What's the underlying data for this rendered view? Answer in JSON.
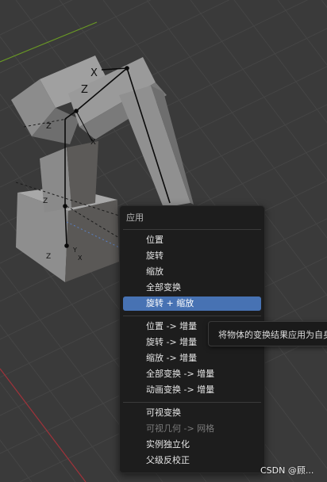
{
  "colors": {
    "viewport_bg": "#3a3a3a",
    "grid_line": "#454545",
    "x_axis": "#a0323a",
    "y_axis": "#6a9a24",
    "menu_bg": "#1d1d1d",
    "menu_highlight": "#4772b3",
    "mesh_light": "#9b9b9b",
    "mesh_dark": "#5c5a58"
  },
  "viewport": {
    "bone_labels": [
      "X",
      "Z",
      "Z",
      "X",
      "Z",
      "Z",
      "Y",
      "X"
    ]
  },
  "menu": {
    "title": "应用",
    "items": [
      {
        "label": "位置"
      },
      {
        "label": "旋转"
      },
      {
        "label": "缩放"
      },
      {
        "label": "全部变换"
      },
      {
        "label": "旋转 + 缩放",
        "state": "highlighted"
      },
      {
        "label": "位置 -> 增量"
      },
      {
        "label": "旋转 -> 增量"
      },
      {
        "label": "缩放 -> 增量"
      },
      {
        "label": "全部变换 -> 增量"
      },
      {
        "label": "动画变换 -> 增量"
      },
      {
        "label": "可视变换"
      },
      {
        "label": "可视几何 -> 网格",
        "state": "disabled"
      },
      {
        "label": "实例独立化"
      },
      {
        "label": "父级反校正"
      }
    ]
  },
  "tooltip": {
    "text": "将物体的变换结果应用为自身"
  },
  "watermark": "CSDN @顾..."
}
